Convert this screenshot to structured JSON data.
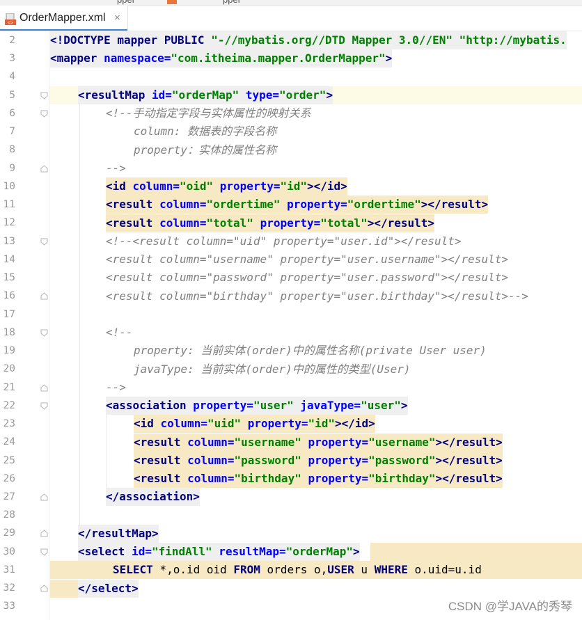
{
  "tab": {
    "label": "OrderMapper.xml",
    "close": "×",
    "other_tab": "pper"
  },
  "watermark": "CSDN @学JAVA的秀琴",
  "colors": {
    "tag": "#000080",
    "attr": "#0000ff",
    "value": "#008000",
    "comment": "#808080",
    "highlight_yellow": "#f7e9c3",
    "highlight_gray": "#efefef",
    "current_line": "#fdfbe6"
  },
  "lines": [
    {
      "n": "2",
      "fold": "none"
    },
    {
      "n": "3",
      "fold": "none"
    },
    {
      "n": "4",
      "fold": "none"
    },
    {
      "n": "5",
      "fold": "open"
    },
    {
      "n": "6",
      "fold": "open"
    },
    {
      "n": "7",
      "fold": "none"
    },
    {
      "n": "8",
      "fold": "none"
    },
    {
      "n": "9",
      "fold": "close"
    },
    {
      "n": "10",
      "fold": "none"
    },
    {
      "n": "11",
      "fold": "none"
    },
    {
      "n": "12",
      "fold": "none"
    },
    {
      "n": "13",
      "fold": "open"
    },
    {
      "n": "14",
      "fold": "none"
    },
    {
      "n": "15",
      "fold": "none"
    },
    {
      "n": "16",
      "fold": "close"
    },
    {
      "n": "17",
      "fold": "none"
    },
    {
      "n": "18",
      "fold": "open"
    },
    {
      "n": "19",
      "fold": "none"
    },
    {
      "n": "20",
      "fold": "none"
    },
    {
      "n": "21",
      "fold": "close"
    },
    {
      "n": "22",
      "fold": "open"
    },
    {
      "n": "23",
      "fold": "none"
    },
    {
      "n": "24",
      "fold": "none"
    },
    {
      "n": "25",
      "fold": "none"
    },
    {
      "n": "26",
      "fold": "none"
    },
    {
      "n": "27",
      "fold": "close"
    },
    {
      "n": "28",
      "fold": "none"
    },
    {
      "n": "29",
      "fold": "close"
    },
    {
      "n": "30",
      "fold": "open"
    },
    {
      "n": "31",
      "fold": "none"
    },
    {
      "n": "32",
      "fold": "close"
    },
    {
      "n": "33",
      "fold": "none"
    }
  ],
  "code": {
    "l2": [
      "<!DOCTYPE mapper PUBLIC ",
      "\"-//mybatis.org//DTD Mapper 3.0//EN\"",
      " ",
      "\"http://mybatis."
    ],
    "l3": [
      "<mapper ",
      "namespace=",
      "\"com.itheima.mapper.OrderMapper\"",
      ">"
    ],
    "l5": [
      "<resultMap ",
      "id=",
      "\"orderMap\"",
      " type=",
      "\"order\"",
      ">"
    ],
    "l6": "<!--手动指定字段与实体属性的映射关系",
    "l7": "column: 数据表的字段名称",
    "l8": "property：实体的属性名称",
    "l9": "-->",
    "l10": [
      "<id ",
      "column=",
      "\"oid\"",
      " property=",
      "\"id\"",
      "></id>"
    ],
    "l11": [
      "<result ",
      "column=",
      "\"ordertime\"",
      " property=",
      "\"ordertime\"",
      "></result>"
    ],
    "l12": [
      "<result ",
      "column=",
      "\"total\"",
      " property=",
      "\"total\"",
      "></result>"
    ],
    "l13": "<!--<result column=\"uid\" property=\"user.id\"></result>",
    "l14": "<result column=\"username\" property=\"user.username\"></result>",
    "l15": "<result column=\"password\" property=\"user.password\"></result>",
    "l16": "<result column=\"birthday\" property=\"user.birthday\"></result>-->",
    "l18": "<!--",
    "l19": "property: 当前实体(order)中的属性名称(private User user)",
    "l20": "javaType: 当前实体(order)中的属性的类型(User)",
    "l21": "-->",
    "l22": [
      "<association ",
      "property=",
      "\"user\"",
      " javaType=",
      "\"user\"",
      ">"
    ],
    "l23": [
      "<id ",
      "column=",
      "\"uid\"",
      " property=",
      "\"id\"",
      "></id>"
    ],
    "l24": [
      "<result ",
      "column=",
      "\"username\"",
      " property=",
      "\"username\"",
      "></result>"
    ],
    "l25": [
      "<result ",
      "column=",
      "\"password\"",
      " property=",
      "\"password\"",
      "></result>"
    ],
    "l26": [
      "<result ",
      "column=",
      "\"birthday\"",
      " property=",
      "\"birthday\"",
      "></result>"
    ],
    "l27": "</association>",
    "l29": "</resultMap>",
    "l30": [
      "<select ",
      "id=",
      "\"findAll\"",
      " resultMap=",
      "\"orderMap\"",
      ">"
    ],
    "l31": [
      "SELECT",
      " *,o.id oid ",
      "FROM",
      " orders o,",
      "USER",
      " u ",
      "WHERE",
      " o.uid=u.id"
    ],
    "l32": "</select>"
  }
}
